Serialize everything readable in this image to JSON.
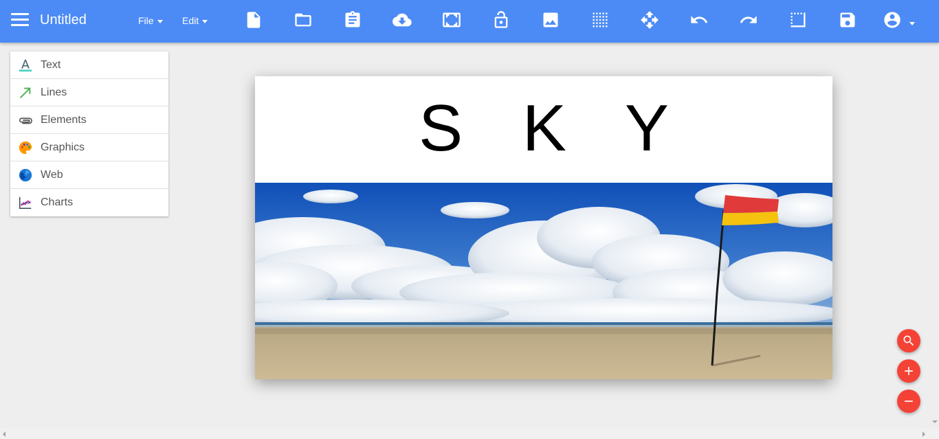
{
  "header": {
    "title": "Untitled",
    "menus": [
      {
        "label": "File"
      },
      {
        "label": "Edit"
      }
    ],
    "toolbar_icons": [
      "new-file-icon",
      "open-folder-icon",
      "clipboard-icon",
      "cloud-download-icon",
      "fit-screen-icon",
      "lock-icon",
      "image-icon",
      "grid-icon",
      "move-icon",
      "undo-icon",
      "redo-icon",
      "border-icon",
      "save-icon",
      "account-icon"
    ],
    "accent_color": "#4c8bf5"
  },
  "panel": {
    "items": [
      {
        "label": "Text",
        "icon": "text-icon"
      },
      {
        "label": "Lines",
        "icon": "arrow-line-icon"
      },
      {
        "label": "Elements",
        "icon": "paperclip-icon"
      },
      {
        "label": "Graphics",
        "icon": "palette-icon"
      },
      {
        "label": "Web",
        "icon": "globe-icon"
      },
      {
        "label": "Charts",
        "icon": "line-chart-icon"
      }
    ]
  },
  "slide": {
    "title": "S K Y",
    "image": "beach-sky-with-flag-photo"
  },
  "fabs": [
    "search-zoom-icon",
    "zoom-in-icon",
    "zoom-out-icon"
  ],
  "fab_color": "#f44336"
}
